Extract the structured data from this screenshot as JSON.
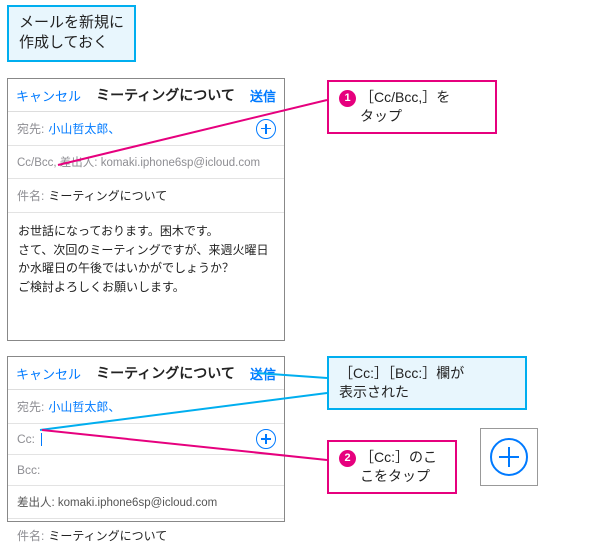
{
  "intro": "メールを新規に\n作成しておく",
  "panel1": {
    "cancel": "キャンセル",
    "title": "ミーティングについて",
    "send": "送信",
    "to_label": "宛先:",
    "to_value": "小山哲太郎、",
    "ccbcc_line": "Cc/Bcc, 差出人: komaki.iphone6sp@icloud.com",
    "subject_label": "件名:",
    "subject_value": "ミーティングについて",
    "body": "お世話になっております。困木です。\nさて、次回のミーティングですが、来週火曜日か水曜日の午後ではいかがでしょうか？\nご検討よろしくお願いします。"
  },
  "callout1": {
    "num": "1",
    "text": "［Cc/Bcc,］を\nタップ"
  },
  "panel2": {
    "cancel": "キャンセル",
    "title": "ミーティングについて",
    "send": "送信",
    "to_label": "宛先:",
    "to_value": "小山哲太郎、",
    "cc_label": "Cc:",
    "bcc_label": "Bcc:",
    "from_line": "差出人: komaki.iphone6sp@icloud.com",
    "subject_label": "件名:",
    "subject_value": "ミーティングについて"
  },
  "info": "［Cc:］［Bcc:］欄が\n表示された",
  "callout2": {
    "num": "2",
    "text": "［Cc:］のこ\nこをタップ"
  }
}
